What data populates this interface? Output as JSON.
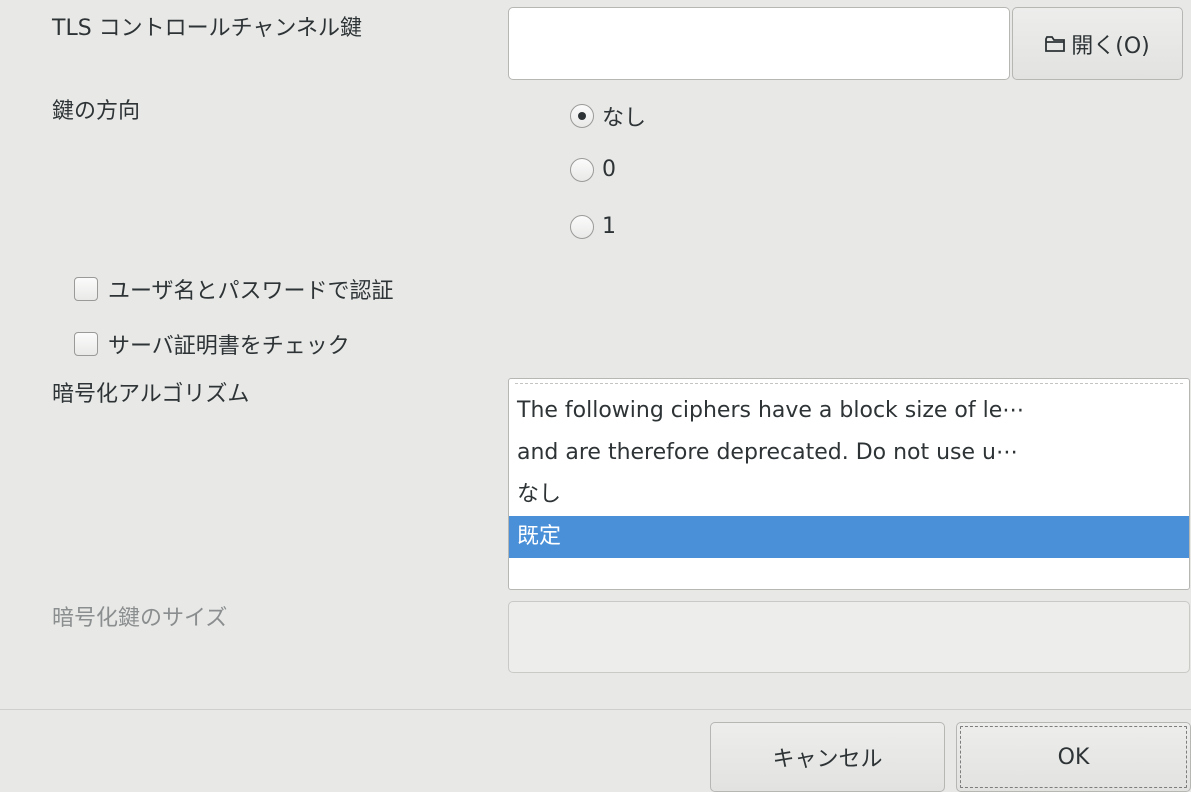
{
  "tls_key": {
    "label": "TLS コントロールチャンネル鍵",
    "value": "",
    "open_button_label": "開く(O)",
    "open_icon": "folder-icon"
  },
  "key_direction": {
    "label": "鍵の方向",
    "options": [
      {
        "label": "なし",
        "selected": true
      },
      {
        "label": "0",
        "selected": false
      },
      {
        "label": "1",
        "selected": false
      }
    ]
  },
  "checkboxes": [
    {
      "label": "ユーザ名とパスワードで認証",
      "checked": false
    },
    {
      "label": "サーバ証明書をチェック",
      "checked": false
    }
  ],
  "cipher": {
    "label": "暗号化アルゴリズム",
    "items": [
      {
        "text": "The following ciphers have a block size of le⋯",
        "selected": false
      },
      {
        "text": "and are therefore deprecated.  Do not use u⋯",
        "selected": false
      },
      {
        "text": "なし",
        "selected": false
      },
      {
        "text": "既定",
        "selected": true
      }
    ],
    "selected_color": "#4a90d9"
  },
  "key_size": {
    "label": "暗号化鍵のサイズ",
    "value": "",
    "disabled": true
  },
  "footer": {
    "cancel_label": "キャンセル",
    "ok_label": "OK"
  }
}
